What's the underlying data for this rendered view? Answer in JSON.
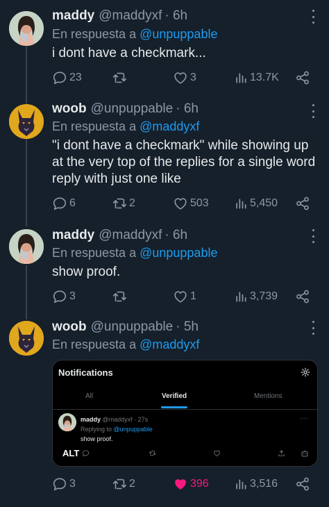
{
  "tweets": [
    {
      "author": "maddy",
      "handle": "@maddyxf",
      "time": "· 6h",
      "reply_label": "En respuesta a",
      "reply_to": "@unpuppable",
      "text": "i dont have a checkmark...",
      "replies": "23",
      "retweets": "",
      "likes": "3",
      "views": "13.7K"
    },
    {
      "author": "woob",
      "handle": "@unpuppable",
      "time": "· 6h",
      "reply_label": "En respuesta a",
      "reply_to": "@maddyxf",
      "text": "\"i dont have a checkmark\" while showing up at the very top of the replies for a single word reply with just one like",
      "replies": "6",
      "retweets": "2",
      "likes": "503",
      "views": "5,450"
    },
    {
      "author": "maddy",
      "handle": "@maddyxf",
      "time": "· 6h",
      "reply_label": "En respuesta a",
      "reply_to": "@unpuppable",
      "text": "show proof.",
      "replies": "3",
      "retweets": "",
      "likes": "1",
      "views": "3,739"
    },
    {
      "author": "woob",
      "handle": "@unpuppable",
      "time": "· 5h",
      "reply_label": "En respuesta a",
      "reply_to": "@maddyxf",
      "text": "",
      "replies": "3",
      "retweets": "2",
      "likes": "396",
      "views": "3,516",
      "liked": true
    }
  ],
  "embedded_screenshot": {
    "title": "Notifications",
    "tabs": [
      "All",
      "Verified",
      "Mentions"
    ],
    "active_tab": "Verified",
    "author": "maddy",
    "handle_time": "@maddyxf · 27s",
    "replying_label": "Replying to",
    "replying_to": "@unpuppable",
    "text": "show proof.",
    "alt_badge": "ALT"
  },
  "colors": {
    "background": "#15202b",
    "text": "#e7e9ea",
    "muted": "#8b98a5",
    "accent": "#1d9bf0",
    "like_active": "#f91880",
    "thread_line": "#38444d"
  },
  "icons": [
    "reply-icon",
    "retweet-icon",
    "heart-icon",
    "views-icon",
    "share-icon",
    "more-icon",
    "gear-icon"
  ]
}
